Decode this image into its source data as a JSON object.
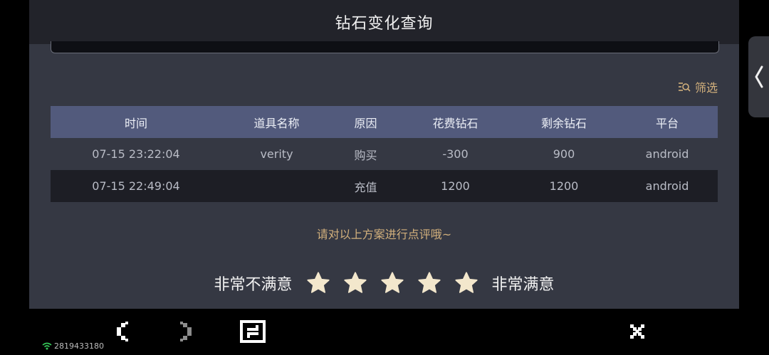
{
  "header": {
    "title": "钻石变化查询"
  },
  "filter": {
    "label": "筛选"
  },
  "table": {
    "columns": [
      "时间",
      "道具名称",
      "原因",
      "花费钻石",
      "剩余钻石",
      "平台"
    ],
    "rows": [
      [
        "07-15 23:22:04",
        "verity",
        "购买",
        "-300",
        "900",
        "android"
      ],
      [
        "07-15 22:49:04",
        "",
        "充值",
        "1200",
        "1200",
        "android"
      ]
    ]
  },
  "rating": {
    "prompt": "请对以上方案进行点评哦~",
    "left_label": "非常不满意",
    "right_label": "非常满意",
    "stars": 5,
    "star_color": "#f3e7cc"
  },
  "status": {
    "network_id": "2819433180"
  },
  "colors": {
    "accent": "#d2b07c",
    "table_header": "#525a7c",
    "panel": "#353843"
  }
}
